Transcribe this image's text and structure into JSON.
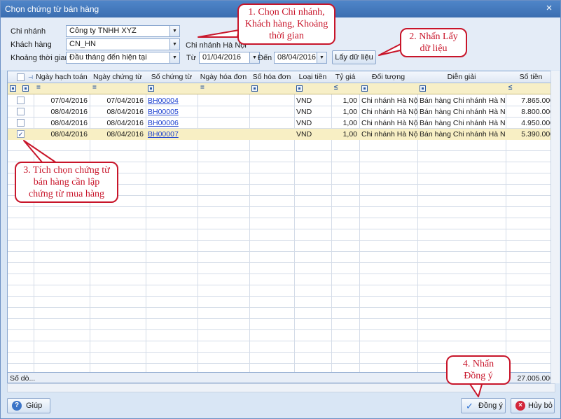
{
  "window": {
    "title": "Chọn chứng từ bán hàng",
    "close_symbol": "×"
  },
  "filters": {
    "branch_label": "Chi nhánh",
    "branch_value": "Công ty TNHH XYZ",
    "customer_label": "Khách hàng",
    "customer_value": "CN_HN",
    "customer_name": "Chi nhánh Hà Nội",
    "period_label": "Khoảng thời gian",
    "period_value": "Đầu tháng đến hiện tại",
    "from_label": "Từ",
    "from_value": "01/04/2016",
    "to_label": "Đến",
    "to_value": "08/04/2016",
    "fetch_button": "Lấy dữ liệu"
  },
  "grid": {
    "columns": [
      "Ngày hạch toán",
      "Ngày chứng từ",
      "Số chứng từ",
      "Ngày hóa đơn",
      "Số hóa đơn",
      "Loại tiền",
      "Tỷ giá",
      "Đối tượng",
      "Diễn giải",
      "Số tiền"
    ],
    "filter_ops": [
      "=",
      "=",
      "",
      "=",
      "",
      "",
      "≤",
      "",
      "",
      "≤"
    ],
    "rows": [
      {
        "checked": false,
        "ngay_hach_toan": "07/04/2016",
        "ngay_chung_tu": "07/04/2016",
        "so_chung_tu": "BH00004",
        "ngay_hoa_don": "",
        "so_hoa_don": "",
        "loai_tien": "VND",
        "ty_gia": "1,00",
        "doi_tuong": "Chi nhánh Hà Nội",
        "dien_giai": "Bán hàng Chi nhánh Hà Nội",
        "so_tien": "7.865.000"
      },
      {
        "checked": false,
        "ngay_hach_toan": "08/04/2016",
        "ngay_chung_tu": "08/04/2016",
        "so_chung_tu": "BH00005",
        "ngay_hoa_don": "",
        "so_hoa_don": "",
        "loai_tien": "VND",
        "ty_gia": "1,00",
        "doi_tuong": "Chi nhánh Hà Nội",
        "dien_giai": "Bán hàng Chi nhánh Hà Nội",
        "so_tien": "8.800.000"
      },
      {
        "checked": false,
        "ngay_hach_toan": "08/04/2016",
        "ngay_chung_tu": "08/04/2016",
        "so_chung_tu": "BH00006",
        "ngay_hoa_don": "",
        "so_hoa_don": "",
        "loai_tien": "VND",
        "ty_gia": "1,00",
        "doi_tuong": "Chi nhánh Hà Nội",
        "dien_giai": "Bán hàng Chi nhánh Hà Nội",
        "so_tien": "4.950.000"
      },
      {
        "checked": true,
        "ngay_hach_toan": "08/04/2016",
        "ngay_chung_tu": "08/04/2016",
        "so_chung_tu": "BH00007",
        "ngay_hoa_don": "",
        "so_hoa_don": "",
        "loai_tien": "VND",
        "ty_gia": "1,00",
        "doi_tuong": "Chi nhánh Hà Nội",
        "dien_giai": "Bán hàng Chi nhánh Hà Nội",
        "so_tien": "5.390.000"
      }
    ],
    "summary_label": "Số dò...",
    "summary_total": "27.005.000",
    "check_mark": "✓"
  },
  "footer": {
    "help_button": "Giúp",
    "ok_button": "Đồng ý",
    "cancel_button": "Hủy bỏ"
  },
  "callouts": {
    "step1": "1. Chọn Chi nhánh, Khách hàng, Khoảng thời gian",
    "step2": "2. Nhấn Lấy dữ liệu",
    "step3": "3. Tích chọn chứng từ bán hàng cần lập chứng từ mua hàng",
    "step4": "4. Nhấn Đồng ý"
  },
  "colors": {
    "accent": "#c8152a",
    "link": "#1a3fd0",
    "selected_row": "#f8efc4"
  },
  "icons": {
    "help": "help-icon",
    "ok": "checkmark-icon",
    "cancel": "cancel-icon"
  }
}
